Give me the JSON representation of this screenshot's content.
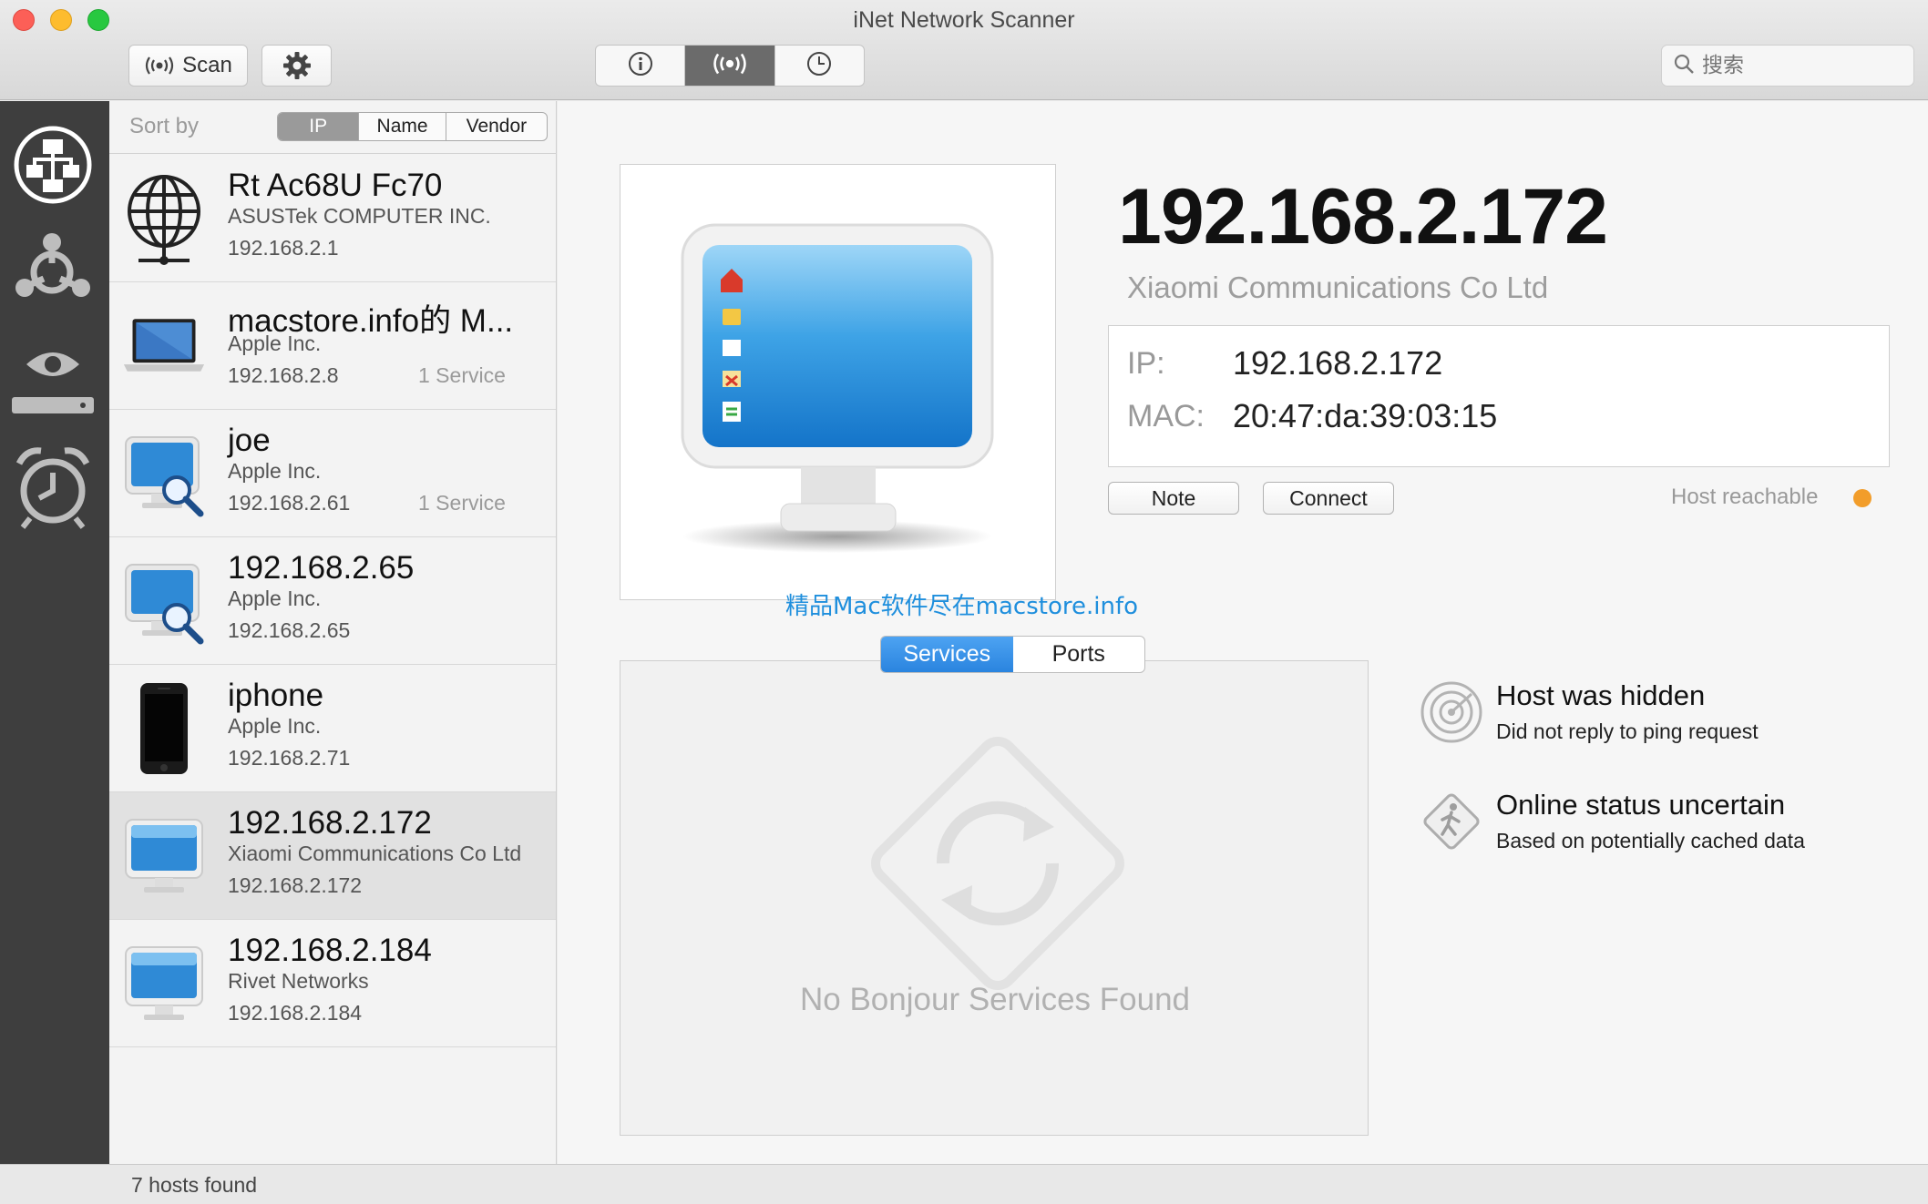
{
  "window": {
    "title": "iNet Network Scanner"
  },
  "toolbar": {
    "scan_label": "Scan",
    "search_placeholder": "搜索",
    "segments": [
      "info",
      "scan",
      "history"
    ],
    "active_segment": "scan"
  },
  "rail": {
    "items": [
      "network-icon",
      "topology-icon",
      "monitor-icon",
      "alarm-icon"
    ],
    "active": "network-icon"
  },
  "sort": {
    "label": "Sort by",
    "options": [
      "IP",
      "Name",
      "Vendor"
    ],
    "selected": "IP"
  },
  "hosts": [
    {
      "name": "Rt Ac68U Fc70",
      "vendor": "ASUSTek COMPUTER INC.",
      "ip": "192.168.2.1",
      "services": "",
      "icon": "globe-icon"
    },
    {
      "name": "macstore.info的 M...",
      "vendor": "Apple Inc.",
      "ip": "192.168.2.8",
      "services": "1 Service",
      "icon": "laptop-icon"
    },
    {
      "name": "joe",
      "vendor": "Apple Inc.",
      "ip": "192.168.2.61",
      "services": "1 Service",
      "icon": "monitor-search-icon"
    },
    {
      "name": "192.168.2.65",
      "vendor": "Apple Inc.",
      "ip": "192.168.2.65",
      "services": "",
      "icon": "monitor-search-icon"
    },
    {
      "name": "iphone",
      "vendor": "Apple Inc.",
      "ip": "192.168.2.71",
      "services": "",
      "icon": "phone-icon"
    },
    {
      "name": "192.168.2.172",
      "vendor": "Xiaomi Communications Co Ltd",
      "ip": "192.168.2.172",
      "services": "",
      "icon": "monitor-icon"
    },
    {
      "name": "192.168.2.184",
      "vendor": "Rivet Networks",
      "ip": "192.168.2.184",
      "services": "",
      "icon": "monitor-icon"
    }
  ],
  "selected_host": {
    "title": "192.168.2.172",
    "vendor": "Xiaomi Communications Co Ltd",
    "ip_label": "IP:",
    "ip": "192.168.2.172",
    "mac_label": "MAC:",
    "mac": "20:47:da:39:03:15",
    "note_button": "Note",
    "connect_button": "Connect",
    "reachability": "Host reachable",
    "reachability_color": "#f29d2a"
  },
  "watermark": "精品Mac软件尽在macstore.info",
  "tabs": {
    "items": [
      "Services",
      "Ports"
    ],
    "active": "Services"
  },
  "services": {
    "empty_text": "No Bonjour Services Found"
  },
  "status_notes": [
    {
      "title": "Host was hidden",
      "subtitle": "Did not reply to ping request",
      "icon": "radar-icon"
    },
    {
      "title": "Online status uncertain",
      "subtitle": "Based on potentially cached data",
      "icon": "pedestrian-sign-icon"
    }
  ],
  "footer": {
    "count_text": "7 hosts found"
  },
  "colors": {
    "accent": "#2a84df",
    "rail": "#3e3e3e",
    "selected_row": "#e1e1e1"
  }
}
